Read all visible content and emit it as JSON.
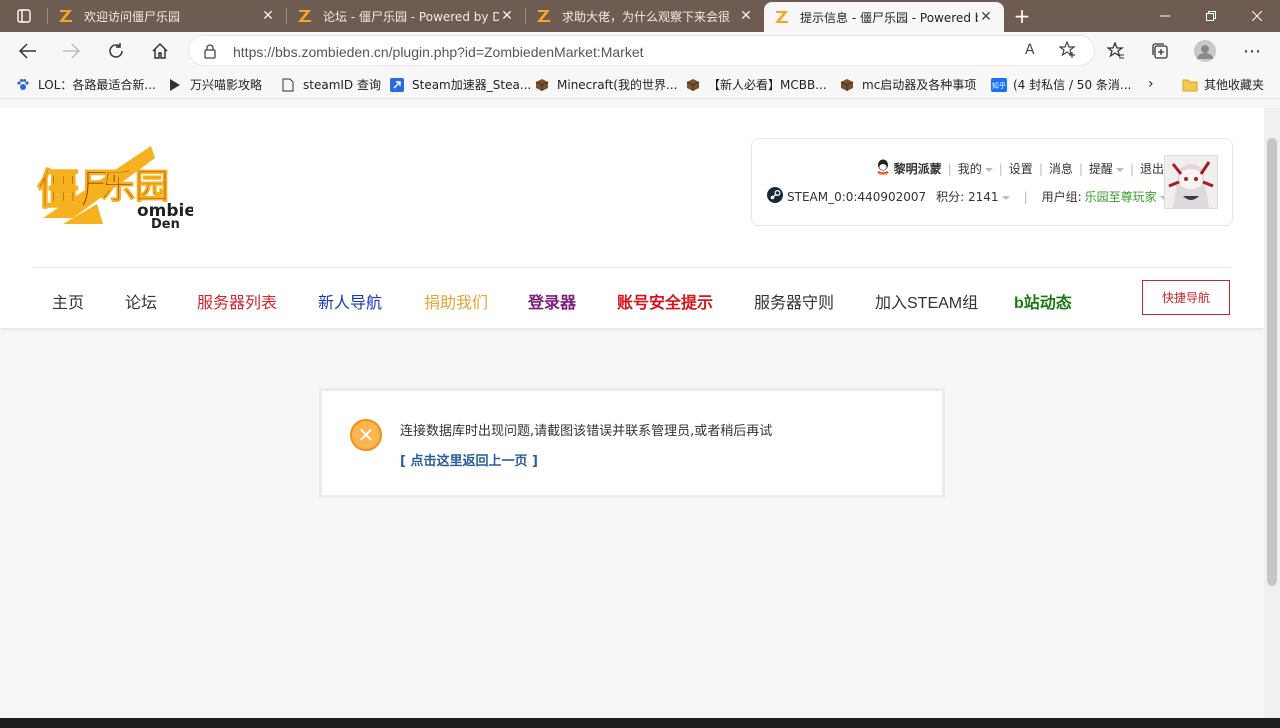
{
  "browser": {
    "tabs": [
      {
        "title": "欢迎访问僵尸乐园"
      },
      {
        "title": "论坛 - 僵尸乐园 - Powered by Di"
      },
      {
        "title": "求助大佬，为什么观察下来会很"
      },
      {
        "title": "提示信息 - 僵尸乐园 - Powered b"
      }
    ],
    "new_tab": "+",
    "url": "https://bbs.zombieden.cn/plugin.php?id=ZombiedenMarket:Market",
    "bookmarks": [
      {
        "label": "LOL：各路最适合新...",
        "icon": "paw-icon"
      },
      {
        "label": "万兴喵影攻略",
        "icon": "play-icon"
      },
      {
        "label": "steamID 查询",
        "icon": "page-icon"
      },
      {
        "label": "Steam加速器_Stea...",
        "icon": "rocket-icon"
      },
      {
        "label": "Minecraft(我的世界...",
        "icon": "block-icon"
      },
      {
        "label": "【新人必看】MCBB...",
        "icon": "block-icon"
      },
      {
        "label": "mc启动器及各种事项",
        "icon": "block-icon"
      },
      {
        "label": "(4 封私信 / 50 条消...",
        "icon": "zhihu-icon"
      }
    ],
    "other_bookmarks": "其他收藏夹"
  },
  "site": {
    "user": {
      "name": "黎明派蒙",
      "my": "我的",
      "settings": "设置",
      "messages": "消息",
      "reminders": "提醒",
      "logout": "退出",
      "steam_id": "STEAM_0:0:440902007",
      "points": "积分: 2141",
      "group_label": "用户组:",
      "group_value": "乐园至尊玩家"
    },
    "nav": [
      {
        "label": "主页",
        "color": "#333333"
      },
      {
        "label": "论坛",
        "color": "#333333"
      },
      {
        "label": "服务器列表",
        "color": "#d1262b"
      },
      {
        "label": "新人导航",
        "color": "#1d36b0"
      },
      {
        "label": "捐助我们",
        "color": "#e7a238"
      },
      {
        "label": "登录器",
        "color": "#7a1f7a"
      },
      {
        "label": "账号安全提示",
        "color": "#d6151a"
      },
      {
        "label": "服务器守则",
        "color": "#333333"
      },
      {
        "label": "加入STEAM组",
        "color": "#333333"
      },
      {
        "label": "b站动态",
        "color": "#1a7a12"
      }
    ],
    "quick_nav": "快捷导航"
  },
  "message": {
    "text": "连接数据库时出现问题,请截图该错误并联系管理员,或者稍后再试",
    "link": "[ 点击这里返回上一页 ]"
  },
  "logo_text": {
    "cn": "僵尸乐园",
    "en1": "ombie",
    "en2": "Den"
  }
}
